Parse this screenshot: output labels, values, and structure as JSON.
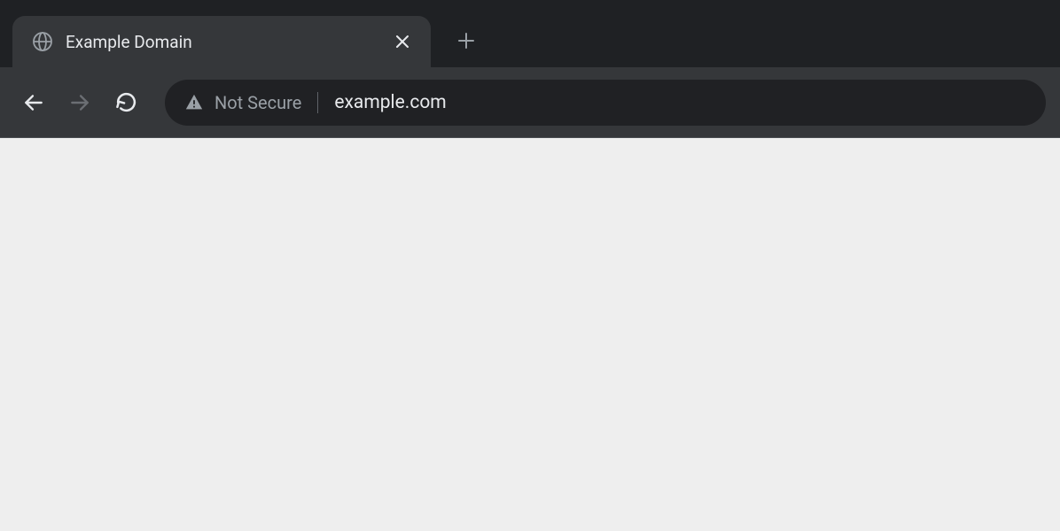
{
  "tab": {
    "title": "Example Domain"
  },
  "addressBar": {
    "securityText": "Not Secure",
    "url": "example.com"
  }
}
